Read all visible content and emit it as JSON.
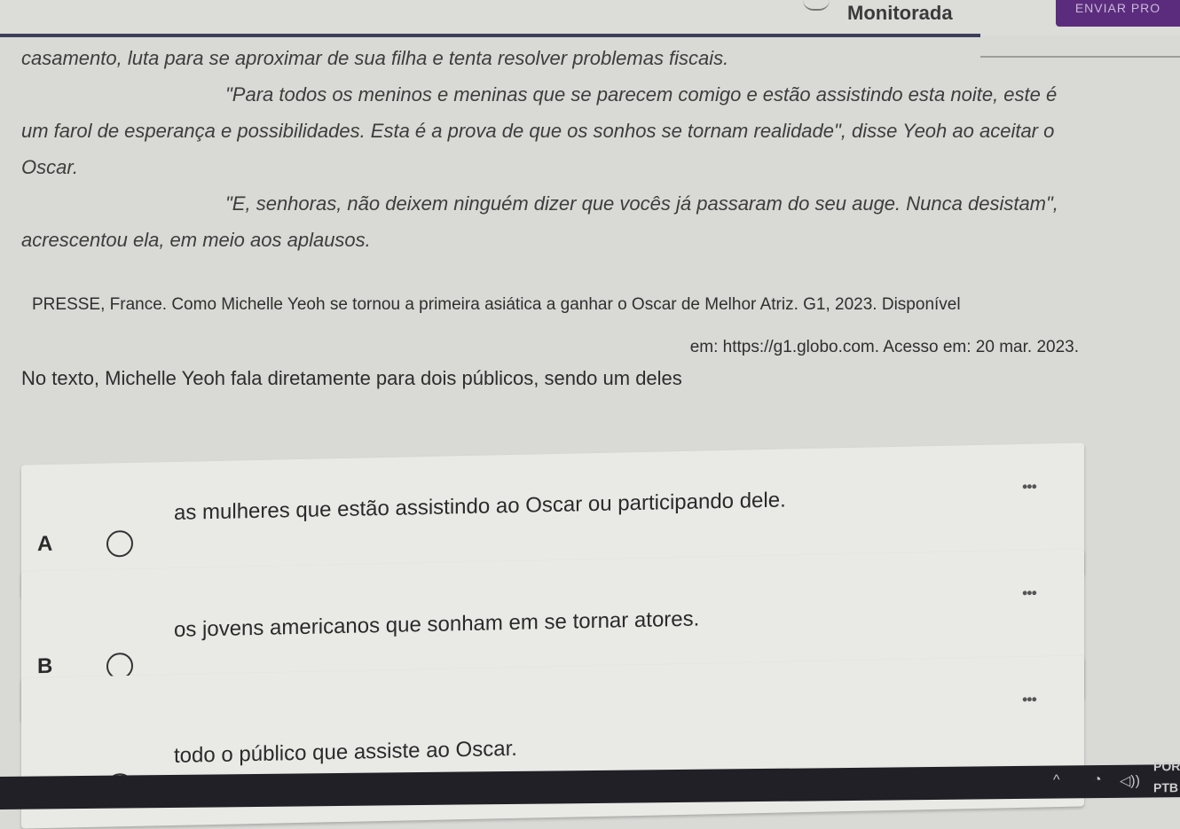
{
  "header": {
    "status_title": "Monitorada",
    "send_label": "ENVIAR PRO"
  },
  "passage": {
    "lines": [
      "casamento, luta para se aproximar de sua filha e tenta resolver problemas fiscais.",
      "\"Para todos os meninos e meninas que se parecem comigo e estão assistindo esta noite, este é um farol de esperança e possibilidades. Esta é a prova de que os sonhos se tornam realidade\", disse Yeoh ao aceitar o Oscar.",
      "\"E, senhoras, não deixem ninguém dizer que vocês já passaram do seu auge. Nunca desistam\", acrescentou ela, em meio aos aplausos."
    ]
  },
  "source": {
    "line1": "PRESSE, France. Como Michelle Yeoh se tornou a primeira asiática a ganhar o Oscar de Melhor Atriz. G1, 2023. Disponível",
    "line2": "em: https://g1.globo.com. Acesso em: 20 mar. 2023."
  },
  "question": "No texto, Michelle Yeoh fala diretamente para dois públicos, sendo um deles",
  "options": [
    {
      "letter": "A",
      "text": "as mulheres que estão assistindo ao Oscar ou participando dele.",
      "more": "•••"
    },
    {
      "letter": "B",
      "text": "os jovens americanos que sonham em se tornar atores.",
      "more": "•••"
    },
    {
      "letter": "C",
      "text": "todo o público que assiste ao Oscar.",
      "more": "•••"
    }
  ],
  "taskbar": {
    "lang_top": "POR",
    "lang_bottom": "PTB",
    "icons": [
      "chevron-up-icon",
      "wifi-icon",
      "speaker-icon"
    ]
  }
}
